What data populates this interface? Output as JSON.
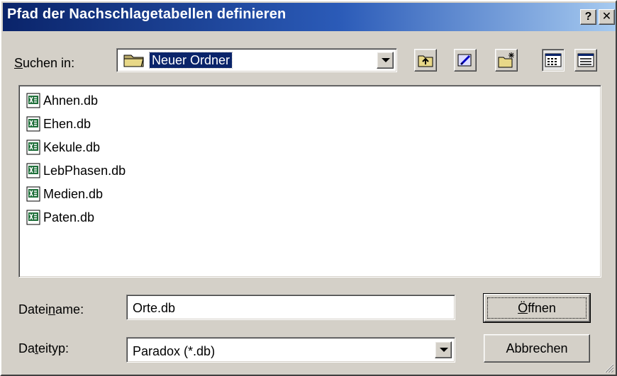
{
  "window": {
    "title": "Pfad der Nachschlagetabellen definieren",
    "help_label": "?",
    "close_label": "✕"
  },
  "lookin": {
    "label_prefix": "S",
    "label_rest": "uchen in:",
    "value": "Neuer Ordner",
    "icon": "folder-icon"
  },
  "toolbar": {
    "icons": [
      "up-folder-icon",
      "desktop-icon",
      "new-folder-icon",
      "list-view-icon",
      "details-view-icon"
    ]
  },
  "files": [
    {
      "name": "Ahnen.db",
      "icon": "database-file-icon"
    },
    {
      "name": "Ehen.db",
      "icon": "database-file-icon"
    },
    {
      "name": "Kekule.db",
      "icon": "database-file-icon"
    },
    {
      "name": "LebPhasen.db",
      "icon": "database-file-icon"
    },
    {
      "name": "Medien.db",
      "icon": "database-file-icon"
    },
    {
      "name": "Paten.db",
      "icon": "database-file-icon"
    }
  ],
  "filename": {
    "label_pre": "Datei",
    "label_u": "n",
    "label_post": "ame:",
    "value": "Orte.db"
  },
  "filetype": {
    "label_pre": "Da",
    "label_u": "t",
    "label_post": "eityp:",
    "value": "Paradox (*.db)"
  },
  "buttons": {
    "open_u": "Ö",
    "open_rest": "ffnen",
    "cancel": "Abbrechen"
  },
  "colors": {
    "titlebar_start": "#0a246a",
    "titlebar_end": "#a6caf0",
    "face": "#d4d0c8",
    "selection": "#0a246a"
  }
}
